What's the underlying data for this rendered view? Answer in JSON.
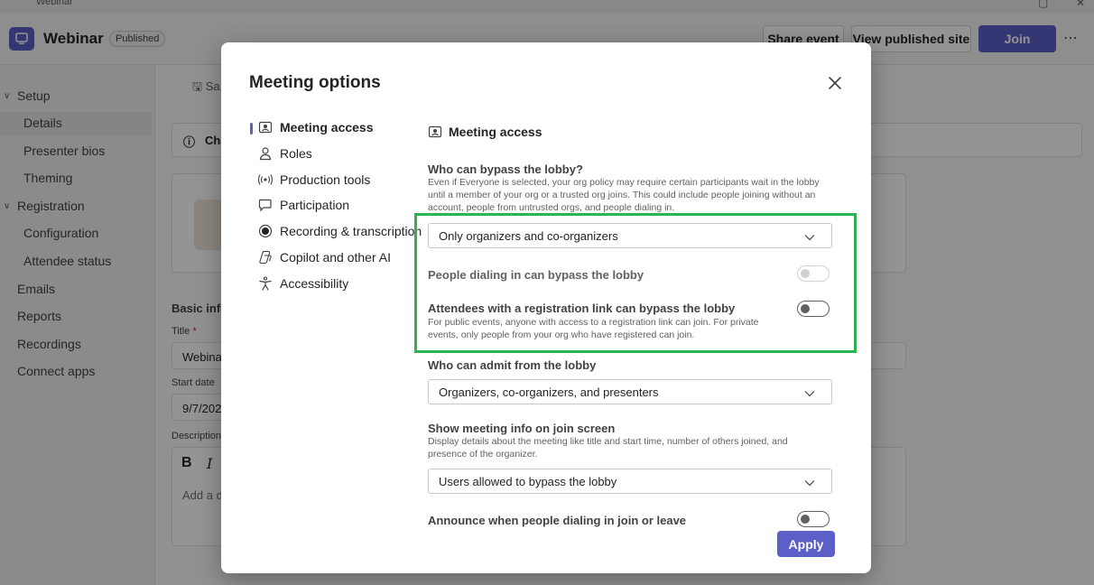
{
  "titlebar": {
    "app_label": "Webinar"
  },
  "header": {
    "title": "Webinar",
    "status_badge": "Published",
    "share_event_label": "Share event",
    "view_site_label": "View published site",
    "join_label": "Join"
  },
  "sidebar": {
    "items": [
      {
        "label": "Setup"
      },
      {
        "label": "Details"
      },
      {
        "label": "Presenter bios"
      },
      {
        "label": "Theming"
      },
      {
        "label": "Registration"
      },
      {
        "label": "Configuration"
      },
      {
        "label": "Attendee status"
      },
      {
        "label": "Emails"
      },
      {
        "label": "Reports"
      },
      {
        "label": "Recordings"
      },
      {
        "label": "Connect apps"
      }
    ]
  },
  "background": {
    "save_label": "Sa",
    "banner_text": "Cha",
    "section_label": "Basic info",
    "title_label": "Title",
    "title_value": "Webina",
    "start_date_label": "Start date",
    "start_date_value": "9/7/202",
    "description_label": "Description",
    "description_placeholder": "Add a d"
  },
  "dialog": {
    "title": "Meeting options",
    "nav": [
      {
        "label": "Meeting access",
        "icon": "meeting-access-icon"
      },
      {
        "label": "Roles",
        "icon": "person-icon"
      },
      {
        "label": "Production tools",
        "icon": "broadcast-icon"
      },
      {
        "label": "Participation",
        "icon": "chat-icon"
      },
      {
        "label": "Recording & transcription",
        "icon": "record-icon"
      },
      {
        "label": "Copilot and other AI",
        "icon": "copilot-icon"
      },
      {
        "label": "Accessibility",
        "icon": "accessibility-icon"
      }
    ],
    "section_title": "Meeting access",
    "bypass_label": "Who can bypass the lobby?",
    "bypass_desc": "Even if Everyone is selected, your org policy may require certain participants wait in the lobby until a member of your org or a trusted org joins. This could include people joining without an account, people from untrusted orgs, and people dialing in.",
    "bypass_value": "Only organizers and co-organizers",
    "dialin_label": "People dialing in can bypass the lobby",
    "reglink_label": "Attendees with a registration link can bypass the lobby",
    "reglink_desc": "For public events, anyone with access to a registration link can join. For private events, only people from your org who have registered can join.",
    "admit_label": "Who can admit from the lobby",
    "admit_value": "Organizers, co-organizers, and presenters",
    "meetinfo_label": "Show meeting info on join screen",
    "meetinfo_desc": "Display details about the meeting like title and start time, number of others joined, and presence of the organizer.",
    "meetinfo_value": "Users allowed to bypass the lobby",
    "announce_label": "Announce when people dialing in join or leave",
    "apply_label": "Apply"
  },
  "colors": {
    "accent": "#5b5fc7",
    "highlight": "#2fb34f"
  }
}
